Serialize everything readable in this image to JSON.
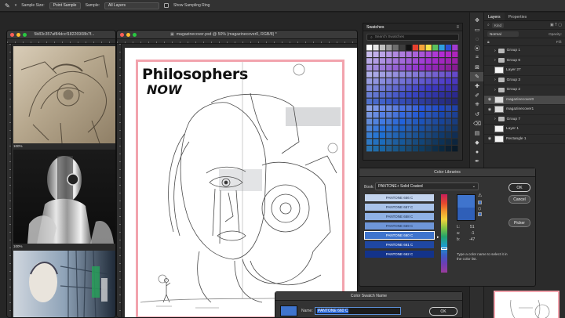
{
  "options_bar": {
    "sample_size_label": "Sample Size:",
    "sample_size_value": "Point Sample",
    "sample_label": "Sample:",
    "sample_value": "All Layers",
    "show_ring_label": "Show Sampling Ring"
  },
  "ref_window": {
    "title": "5b83c357af84dccf18226908b7f...",
    "zoom_top": "100%",
    "zoom_bottom": "100%"
  },
  "doc_window": {
    "title": "magazinecover.psd @ 50% (magazinecover0, RGB/8) *",
    "headline_1": "Philosophers",
    "headline_2": "NOW"
  },
  "swatches_panel": {
    "title": "Swatches",
    "search_placeholder": "Search Swatches"
  },
  "layers_panel": {
    "tabs": [
      "Layers",
      "Properties"
    ],
    "blend_mode": "Normal",
    "opacity_label": "Opacity:",
    "fill_label": "Fill:",
    "kind_label": "Kind",
    "layers": [
      {
        "name": "Group 1",
        "type": "folder",
        "selected": false
      },
      {
        "name": "Group 6",
        "type": "folder",
        "selected": false
      },
      {
        "name": "Layer 27",
        "type": "layer",
        "selected": false
      },
      {
        "name": "Group 3",
        "type": "folder",
        "selected": false
      },
      {
        "name": "Group 2",
        "type": "folder",
        "selected": false
      },
      {
        "name": "magazinecover0",
        "type": "image",
        "selected": true
      },
      {
        "name": "magazinecover1",
        "type": "image",
        "selected": false
      },
      {
        "name": "Group 7",
        "type": "folder",
        "selected": false
      },
      {
        "name": "Layer 1",
        "type": "layer",
        "selected": false
      },
      {
        "name": "Rectangle 1",
        "type": "layer",
        "selected": false
      }
    ]
  },
  "color_libraries": {
    "title": "Color Libraries",
    "book_label": "Book:",
    "book_value": "PANTONE+ Solid Coated",
    "colors": [
      {
        "name": "PANTONE 656 C",
        "hex": "#c3d4ee"
      },
      {
        "name": "PANTONE 657 C",
        "hex": "#a9c3ea"
      },
      {
        "name": "PANTONE 658 C",
        "hex": "#8fb1e4"
      },
      {
        "name": "PANTONE 659 C",
        "hex": "#6e96d8"
      },
      {
        "name": "PANTONE 660 C",
        "hex": "#3f74cd"
      },
      {
        "name": "PANTONE 661 C",
        "hex": "#1f47a3"
      },
      {
        "name": "PANTONE 662 C",
        "hex": "#13338a"
      }
    ],
    "selected_index": 4,
    "lab_l_label": "L:",
    "lab_l_value": "51",
    "lab_a_label": "a:",
    "lab_a_value": "-1",
    "lab_b_label": "b:",
    "lab_b_value": "-47",
    "hint": "Type a color name to select it in the color list.",
    "ok": "OK",
    "cancel": "Cancel",
    "picker": "Picker"
  },
  "swatch_name_dialog": {
    "title": "Color Swatch Name",
    "name_label": "Name:",
    "name_value": "PANTONE 660 C",
    "ok": "OK"
  },
  "colors": {
    "accent_pink": "#f2a3ad",
    "selected_blue": "#3f74cd"
  }
}
